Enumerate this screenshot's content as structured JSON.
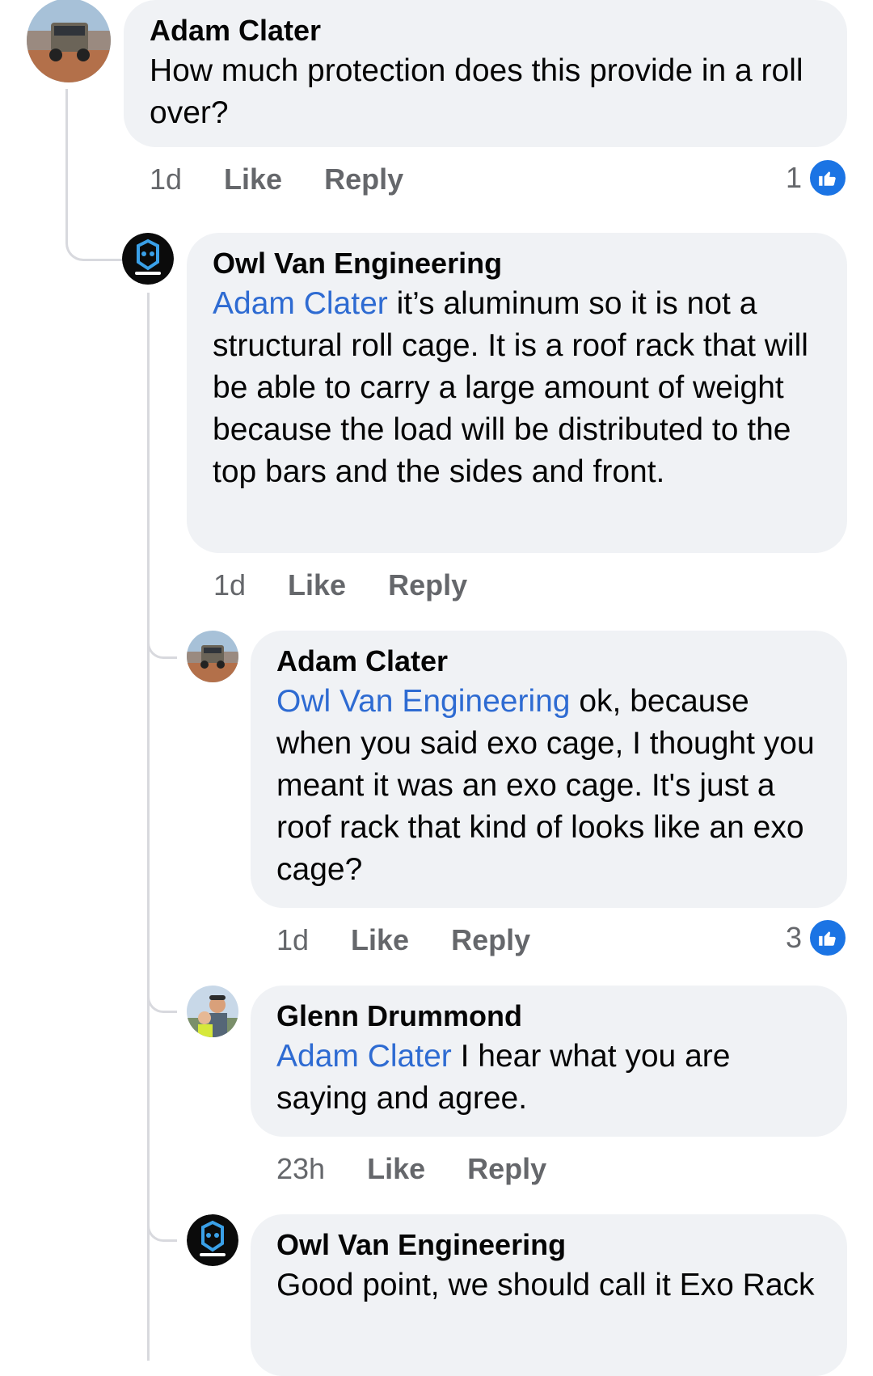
{
  "comments": [
    {
      "author": "Adam Clater",
      "mention": "",
      "text": "How much protection does this provide in a roll over?",
      "time": "1d",
      "like_label": "Like",
      "reply_label": "Reply",
      "reaction_count": "1",
      "avatar_icon": "jeep-photo-avatar"
    },
    {
      "author": "Owl Van Engineering",
      "mention": "Adam Clater",
      "text": " it’s aluminum so it is not a structural roll cage. It is a roof rack that will be able to carry a large amount of weight because the load will be distributed to the top bars and the sides and front.",
      "time": "1d",
      "like_label": "Like",
      "reply_label": "Reply",
      "reaction_count": "",
      "avatar_icon": "owl-logo-avatar"
    },
    {
      "author": "Adam Clater",
      "mention": "Owl Van Engineering",
      "text": " ok, because when you said exo cage, I thought you meant it was an exo cage. It's just a roof rack that kind of looks like an exo cage?",
      "time": "1d",
      "like_label": "Like",
      "reply_label": "Reply",
      "reaction_count": "3",
      "avatar_icon": "jeep-photo-avatar"
    },
    {
      "author": "Glenn Drummond",
      "mention": "Adam Clater",
      "text": " I hear what you are saying and agree.",
      "time": "23h",
      "like_label": "Like",
      "reply_label": "Reply",
      "reaction_count": "",
      "avatar_icon": "person-photo-avatar"
    },
    {
      "author": "Owl Van Engineering",
      "mention": "",
      "text": "Good point, we should call it Exo Rack",
      "time": "",
      "like_label": "",
      "reply_label": "",
      "reaction_count": "",
      "avatar_icon": "owl-logo-avatar"
    }
  ],
  "colors": {
    "bubble": "#f0f2f5",
    "mention": "#2e6bd2",
    "meta": "#65676b",
    "like_badge": "#1b74e4",
    "thread_line": "#d8d9de"
  }
}
